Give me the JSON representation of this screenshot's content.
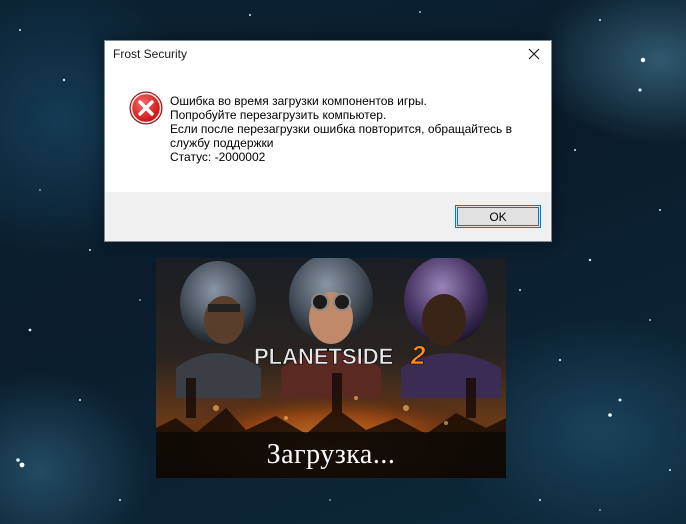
{
  "dialog": {
    "title": "Frost Security",
    "icon": "error-icon",
    "message_lines": [
      "Ошибка во время загрузки компонентов игры.",
      "Попробуйте перезагрузить компьютер.",
      "Если после перезагрузки ошибка повторится, обращайтесь в службу поддержки",
      "Статус: -2000002"
    ],
    "ok_label": "OK",
    "close_icon": "close-icon"
  },
  "splash": {
    "logo_text": "PLANETSIDE",
    "logo_number": "2",
    "loading_text": "Загрузка..."
  },
  "colors": {
    "accent": "#0078d7",
    "error_red": "#d32f2f",
    "footer_bg": "#f0f0f0"
  }
}
